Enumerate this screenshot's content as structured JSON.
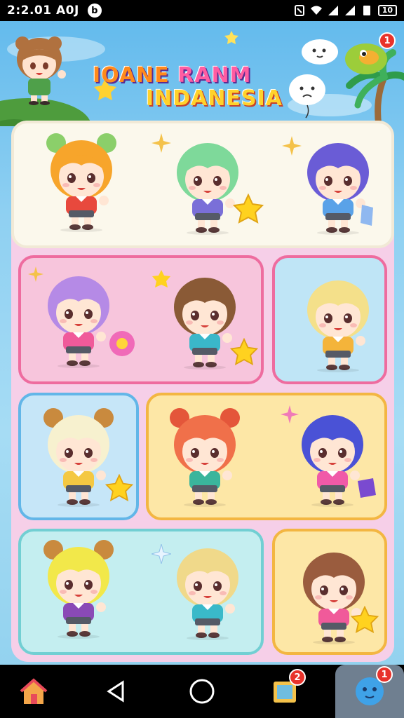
{
  "status_bar": {
    "time": "2:2.01 A0J",
    "notification_glyph": "b",
    "battery": "10"
  },
  "game": {
    "title_line1_a": "IOANE ",
    "title_line1_b": "RANM",
    "title_line2": "INDANESIA"
  },
  "badges": {
    "top_right": "1",
    "nav_tasks": "2",
    "nav_profile": "1"
  },
  "characters": [
    {
      "id": "c1",
      "hair": "#f7a52b",
      "shirt": "#e8493d",
      "ears": "#8bcf6a"
    },
    {
      "id": "c2",
      "hair": "#7ed99a",
      "shirt": "#7a6fd8"
    },
    {
      "id": "c3",
      "hair": "#6a5cd6",
      "shirt": "#5aa2e8"
    },
    {
      "id": "c4",
      "hair": "#b58ae6",
      "shirt": "#f05a9a"
    },
    {
      "id": "c5",
      "hair": "#8a5a36",
      "shirt": "#3ab7c9"
    },
    {
      "id": "c6",
      "hair": "#f4e08a",
      "shirt": "#f4b43a"
    },
    {
      "id": "c7",
      "hair": "#f7f1cf",
      "shirt": "#f4c842",
      "ears": "#c98a3e"
    },
    {
      "id": "c8",
      "hair": "#f0704a",
      "shirt": "#3ab59c",
      "ears": "#e4563a"
    },
    {
      "id": "c9",
      "hair": "#4a52d6",
      "shirt": "#f05aa8"
    },
    {
      "id": "c10",
      "hair": "#f2e84a",
      "shirt": "#8a4ab6",
      "ears": "#c98a3e"
    },
    {
      "id": "c11",
      "hair": "#f0d98a",
      "shirt": "#3ab9c9"
    },
    {
      "id": "c12",
      "hair": "#9a5c3e",
      "shirt": "#f05a9a"
    }
  ],
  "colors": {
    "sky": "#5fb8ec",
    "board": "#f6cfe8",
    "badge": "#e8322b"
  },
  "nav": {
    "items": [
      "home-icon",
      "back-icon",
      "home-circle-icon",
      "tasks-icon",
      "profile-icon"
    ]
  }
}
